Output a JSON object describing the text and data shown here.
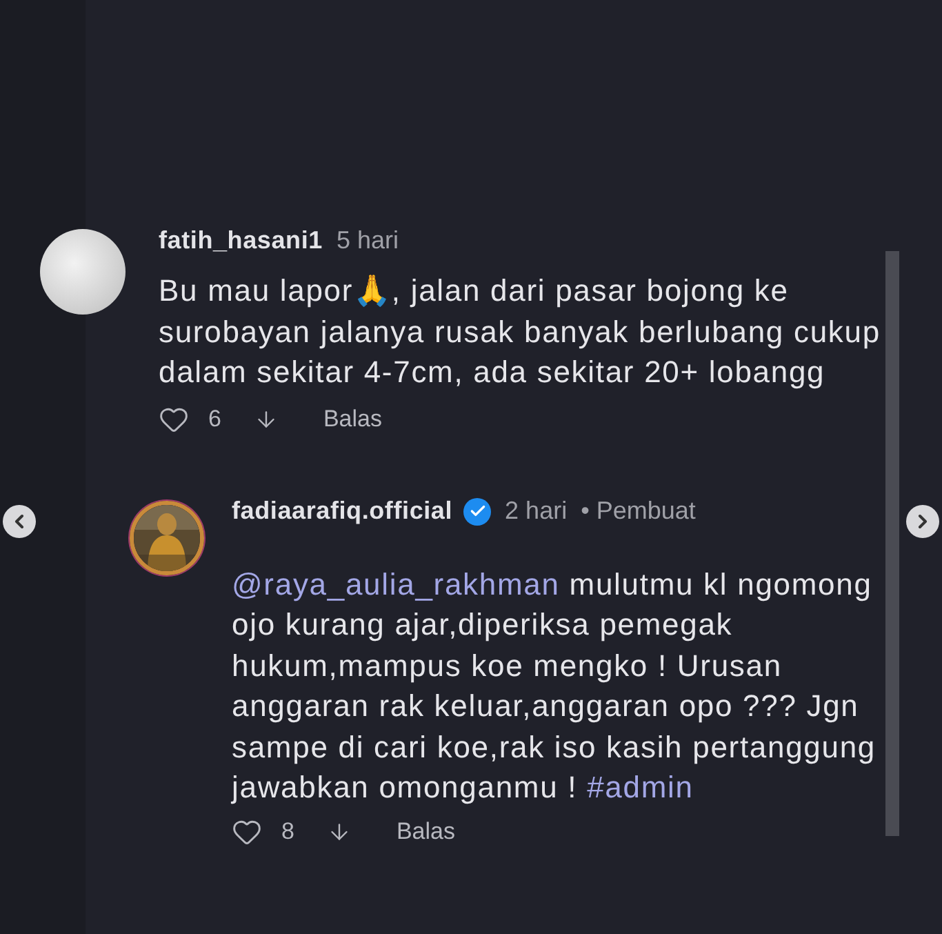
{
  "comments": [
    {
      "kind": "comment",
      "username": "fatih_hasani1",
      "verified": false,
      "time": "5 hari",
      "body": [
        {
          "kind": "text",
          "text": "Bu mau lapor🙏, jalan dari pasar bojong ke surobayan jalanya rusak banyak berlubang cukup dalam sekitar 4-7cm, ada sekitar 20+ lobangg"
        }
      ],
      "likes": "6",
      "reply": "Balas"
    },
    {
      "kind": "reply",
      "username": "fadiaarafiq.official",
      "verified": true,
      "time": "2 hari",
      "role": "• Pembuat",
      "body": [
        {
          "kind": "mention",
          "text": "@raya_aulia_rakhman"
        },
        {
          "kind": "text",
          "text": " mulutmu kl ngomong ojo kurang ajar,diperiksa pemegak hukum,mampus koe mengko ! Urusan anggaran rak keluar,anggaran opo ??? Jgn sampe di cari koe,rak iso kasih pertanggung jawabkan omonganmu ! "
        },
        {
          "kind": "hashtag",
          "text": "#admin"
        }
      ],
      "likes": "8",
      "reply": "Balas"
    }
  ]
}
